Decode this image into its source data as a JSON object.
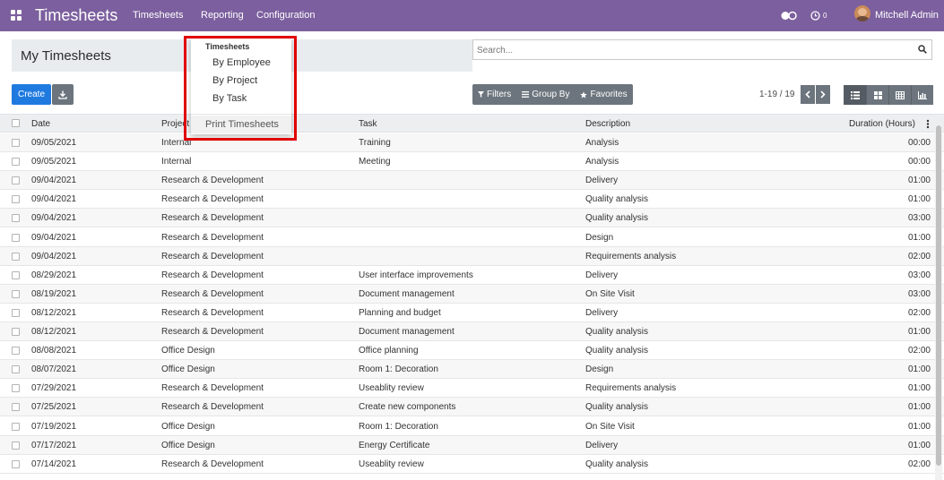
{
  "app": {
    "title": "Timesheets"
  },
  "nav": {
    "menu": [
      "Timesheets",
      "Reporting",
      "Configuration"
    ],
    "activity_count": "0",
    "user_name": "Mitchell Admin"
  },
  "control": {
    "page_title": "My Timesheets",
    "search_placeholder": "Search...",
    "create_label": "Create",
    "filters_label": "Filters",
    "groupby_label": "Group By",
    "favorites_label": "Favorites",
    "pager": "1-19 / 19"
  },
  "dropdown": {
    "header": "Timesheets",
    "items": [
      "By Employee",
      "By Project",
      "By Task"
    ],
    "print_label": "Print Timesheets"
  },
  "table": {
    "headers": [
      "Date",
      "Project",
      "Task",
      "Description",
      "Duration (Hours)"
    ],
    "rows": [
      [
        "09/05/2021",
        "Internal",
        "Training",
        "Analysis",
        "00:00"
      ],
      [
        "09/05/2021",
        "Internal",
        "Meeting",
        "Analysis",
        "00:00"
      ],
      [
        "09/04/2021",
        "Research & Development",
        "",
        "Delivery",
        "01:00"
      ],
      [
        "09/04/2021",
        "Research & Development",
        "",
        "Quality analysis",
        "01:00"
      ],
      [
        "09/04/2021",
        "Research & Development",
        "",
        "Quality analysis",
        "03:00"
      ],
      [
        "09/04/2021",
        "Research & Development",
        "",
        "Design",
        "01:00"
      ],
      [
        "09/04/2021",
        "Research & Development",
        "",
        "Requirements analysis",
        "02:00"
      ],
      [
        "08/29/2021",
        "Research & Development",
        "User interface improvements",
        "Delivery",
        "03:00"
      ],
      [
        "08/19/2021",
        "Research & Development",
        "Document management",
        "On Site Visit",
        "03:00"
      ],
      [
        "08/12/2021",
        "Research & Development",
        "Planning and budget",
        "Delivery",
        "02:00"
      ],
      [
        "08/12/2021",
        "Research & Development",
        "Document management",
        "Quality analysis",
        "01:00"
      ],
      [
        "08/08/2021",
        "Office Design",
        "Office planning",
        "Quality analysis",
        "02:00"
      ],
      [
        "08/07/2021",
        "Office Design",
        "Room 1: Decoration",
        "Design",
        "01:00"
      ],
      [
        "07/29/2021",
        "Research & Development",
        "Useablity review",
        "Requirements analysis",
        "01:00"
      ],
      [
        "07/25/2021",
        "Research & Development",
        "Create new components",
        "Quality analysis",
        "01:00"
      ],
      [
        "07/19/2021",
        "Office Design",
        "Room 1: Decoration",
        "On Site Visit",
        "01:00"
      ],
      [
        "07/17/2021",
        "Office Design",
        "Energy Certificate",
        "Delivery",
        "01:00"
      ],
      [
        "07/14/2021",
        "Research & Development",
        "Useablity review",
        "Quality analysis",
        "02:00"
      ]
    ]
  }
}
